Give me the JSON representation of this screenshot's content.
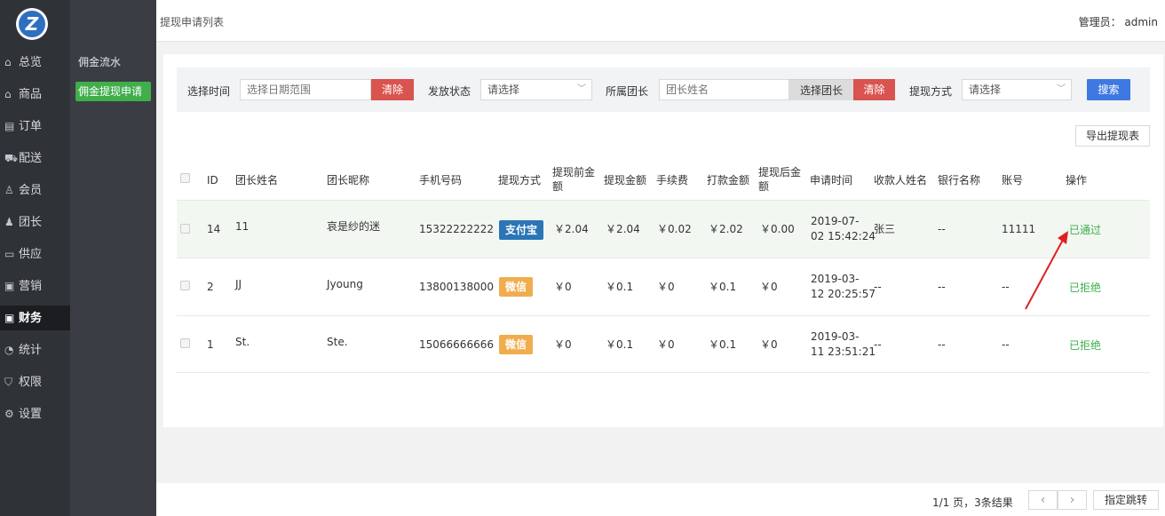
{
  "header": {
    "title": "提现申请列表",
    "admin": "管理员： admin"
  },
  "nav": [
    {
      "label": "总览",
      "icon": "home-icon"
    },
    {
      "label": "商品",
      "icon": "goods-icon"
    },
    {
      "label": "订单",
      "icon": "order-icon"
    },
    {
      "label": "配送",
      "icon": "delivery-icon"
    },
    {
      "label": "会员",
      "icon": "member-icon"
    },
    {
      "label": "团长",
      "icon": "leader-icon"
    },
    {
      "label": "供应",
      "icon": "supply-icon"
    },
    {
      "label": "营销",
      "icon": "gift-icon"
    },
    {
      "label": "财务",
      "icon": "finance-icon"
    },
    {
      "label": "统计",
      "icon": "stats-icon"
    },
    {
      "label": "权限",
      "icon": "shield-icon"
    },
    {
      "label": "设置",
      "icon": "gear-icon"
    }
  ],
  "subnav": [
    {
      "label": "佣金流水"
    },
    {
      "label": "佣金提现申请"
    }
  ],
  "filter": {
    "time_label": "选择时间",
    "time_placeholder": "选择日期范围",
    "clear": "清除",
    "status_label": "发放状态",
    "status_value": "请选择",
    "leader_label": "所属团长",
    "leader_placeholder": "团长姓名",
    "choose_leader": "选择团长",
    "method_label": "提现方式",
    "method_value": "请选择",
    "search": "搜索"
  },
  "export_label": "导出提现表",
  "table": {
    "headers": {
      "id": "ID",
      "name": "团长姓名",
      "nickname": "团长昵称",
      "phone": "手机号码",
      "method": "提现方式",
      "before_1": "提现前金",
      "before_2": "额",
      "amount": "提现金额",
      "fee": "手续费",
      "paid": "打款金额",
      "after_1": "提现后金",
      "after_2": "额",
      "time": "申请时间",
      "payee": "收款人姓名",
      "bank": "银行名称",
      "account": "账号",
      "action": "操作"
    },
    "rows": [
      {
        "id": "14",
        "name": "11",
        "nickname": "哀是纱的迷",
        "phone": "15322222222",
        "method": "支付宝",
        "before": "￥2.04",
        "amount": "￥2.04",
        "fee": "￥0.02",
        "paid": "￥2.02",
        "after": "￥0.00",
        "date": "2019-07-",
        "time": "02 15:42:24",
        "payee": "张三",
        "bank": "--",
        "account": "11111",
        "status": "已通过"
      },
      {
        "id": "2",
        "name": "JJ",
        "nickname": "Jyoung",
        "phone": "13800138000",
        "method": "微信",
        "before": "￥0",
        "amount": "￥0.1",
        "fee": "￥0",
        "paid": "￥0.1",
        "after": "￥0",
        "date": "2019-03-",
        "time": "12 20:25:57",
        "payee": "--",
        "bank": "--",
        "account": "--",
        "status": "已拒绝"
      },
      {
        "id": "1",
        "name": "St.",
        "nickname": "Ste.",
        "phone": "15066666666",
        "method": "微信",
        "before": "￥0",
        "amount": "￥0.1",
        "fee": "￥0",
        "paid": "￥0.1",
        "after": "￥0",
        "date": "2019-03-",
        "time": "11 23:51:21",
        "payee": "--",
        "bank": "--",
        "account": "--",
        "status": "已拒绝"
      }
    ]
  },
  "footer": {
    "page_info": "1/1 页，3条结果",
    "prev": "‹",
    "next": "›",
    "jump": "指定跳转"
  },
  "colors": {
    "accent_green": "#3fae4b",
    "danger": "#d9534f",
    "primary": "#3f78e0",
    "alipay": "#2a75b5",
    "wechat": "#f0ad4e",
    "arrow": "#e02020"
  }
}
